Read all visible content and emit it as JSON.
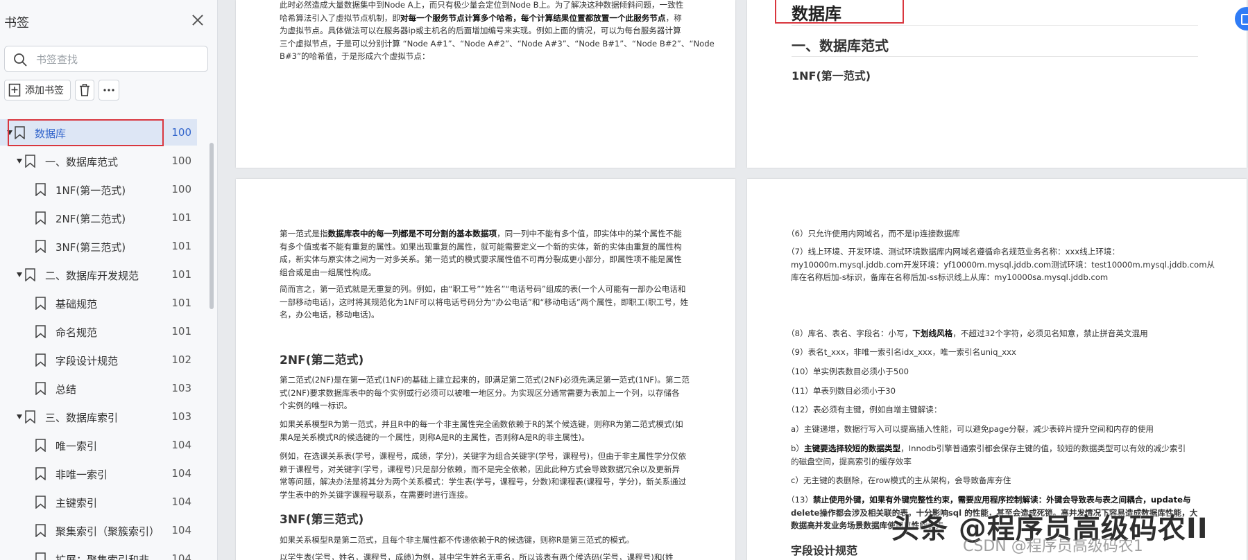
{
  "sidebar": {
    "title": "书签",
    "search_placeholder": "书签查找",
    "add_bookmark_label": "添加书签",
    "items": [
      {
        "label": "数据库",
        "page": "100"
      },
      {
        "label": "一、数据库范式",
        "page": "100"
      },
      {
        "label": "1NF(第一范式)",
        "page": "100"
      },
      {
        "label": "2NF(第二范式)",
        "page": "101"
      },
      {
        "label": "3NF(第三范式)",
        "page": "101"
      },
      {
        "label": "二、数据库开发规范",
        "page": "101"
      },
      {
        "label": "基础规范",
        "page": "101"
      },
      {
        "label": "命名规范",
        "page": "101"
      },
      {
        "label": "字段设计规范",
        "page": "102"
      },
      {
        "label": "总结",
        "page": "103"
      },
      {
        "label": "三、数据库索引",
        "page": "103"
      },
      {
        "label": "唯一索引",
        "page": "104"
      },
      {
        "label": "非唯一索引",
        "page": "104"
      },
      {
        "label": "主键索引",
        "page": "104"
      },
      {
        "label": "聚集索引（聚簇索引）",
        "page": "104"
      },
      {
        "label": "扩展：聚集索引和非",
        "page": "104"
      }
    ]
  },
  "page1": {
    "l1": "此时必然造成大量数据集中到Node A上，而只有极少量会定位到Node B上。为了解决这种数据倾斜问题，一致性",
    "l2a": "哈希算法引入了虚拟节点机制，即",
    "l2b": "对每一个服务节点计算多个哈希，每个计算结果位置都放置一个此服务节点",
    "l2c": "，称",
    "l3": "为虚拟节点。具体做法可以在服务器ip或主机名的后面增加编号来实现。例如上面的情况，可以为每台服务器计算",
    "l4": "三个虚拟节点，于是可以分别计算 “Node A#1”、“Node A#2”、“Node A#3”、“Node B#1”、“Node B#2”、“Node",
    "l5": "B#3”的哈希值，于是形成六个虚拟节点："
  },
  "page2": {
    "h1": "数据库",
    "h2": "一、数据库范式",
    "h3": "1NF(第一范式)"
  },
  "page3": {
    "p1l1a": "第一范式是指",
    "p1l1b": "数据库表中的每一列都是不可分割的基本数据项",
    "p1l1c": "，同一列中不能有多个值，即实体中的某个属性不能",
    "p1l2": "有多个值或者不能有重复的属性。如果出现重复的属性，就可能需要定义一个新的实体，新的实体由重复的属性构",
    "p1l3": "成，新实体与原实体之间为一对多关系。第一范式的模式要求属性值不可再分裂成更小部分，即属性项不能是属性",
    "p1l4": "组合或是由一组属性构成。",
    "p2l1": "简而言之，第一范式就是无重复的列。例如，由“职工号”“姓名”“电话号码”组成的表(一个人可能有一部办公电话和",
    "p2l2": "一部移动电话)，这时将其规范化为1NF可以将电话号码分为“办公电话”和“移动电话”两个属性，即职工(职工号，姓",
    "p2l3": "名，办公电话，移动电话)。",
    "h2nf": "2NF(第二范式)",
    "p3l1": "第二范式(2NF)是在第一范式(1NF)的基础上建立起来的，即满足第二范式(2NF)必须先满足第一范式(1NF)。第二范",
    "p3l2": "式(2NF)要求数据库表中的每个实例或行必须可以被唯一地区分。为实现区分通常需要为表加上一个列，以存储各",
    "p3l3": "个实例的唯一标识。",
    "p4l1": "如果关系模型R为第一范式，并且R中的每一个非主属性完全函数依赖于R的某个候选键，则称R为第二范式模式(如",
    "p4l2": "果A是关系模式R的候选键的一个属性，则称A是R的主属性，否则称A是R的非主属性)。",
    "p5l1": "例如，在选课关系表(学号，课程号，成绩，学分)，关键字为组合关键字(学号，课程号)，但由于非主属性学分仅依",
    "p5l2": "赖于课程号，对关键字(学号，课程号)只是部分依赖，而不是完全依赖，因此此种方式会导致数据冗余以及更新异",
    "p5l3": "常等问题，解决办法是将其分为两个关系模式：学生表(学号，课程号，分数)和课程表(课程号，学分)，新关系通过",
    "p5l4": "学生表中的外关键字课程号联系，在需要时进行连接。",
    "h3nf": "3NF(第三范式)",
    "p6l1": "如果关系模型R是第二范式，且每个非主属性都不传递依赖于R的候选键，则称R是第三范式的模式。",
    "p7l1": "以学生表(学号，姓名，课程号，成绩)为例，其中学生姓名无重名，所以该表有两个候选码(学号，课程号)和(姓"
  },
  "page4": {
    "r6": "（6）只允许使用内网域名，而不是ip连接数据库",
    "r7l1": "（7）线上环境、开发环境、测试环境数据库内网域名遵循命名规范业务名称：xxx线上环境：",
    "r7l2": "my10000m.mysql.jddb.com开发环境：yf10000m.mysql.jddb.com测试环境：test10000m.mysql.jddb.com从",
    "r7l3": "库在名称后加-s标识，备库在名称后加-ss标识线上从库：my10000sa.mysql.jddb.com",
    "r8a": "（8）库名、表名、字段名：小写，",
    "r8b": "下划线风格",
    "r8c": "，不超过32个字符，必须见名知意，禁止拼音英文混用",
    "r9": "（9）表名t_xxx，非唯一索引名idx_xxx，唯一索引名uniq_xxx",
    "r10": "（10）单实例表数目必须小于500",
    "r11": "（11）单表列数目必须小于30",
    "r12": "（12）表必须有主键，例如自增主键解读：",
    "ra": "a）主键递增，数据行写入可以提高插入性能，可以避免page分裂，减少表碎片提升空间和内存的使用",
    "rb1a": "b）",
    "rb1b": "主键要选择较短的数据类型",
    "rb1c": "，Innodb引擎普通索引都会保存主键的值，较短的数据类型可以有效的减少索引",
    "rb2": "的磁盘空间，提高索引的缓存效率",
    "rc": "c）无主键的表删除，在row模式的主从架构，会导致备库夯住",
    "r13l1a": "（13）",
    "r13l1b": "禁止使用外键，如果有外键完整性约束，需要应用程序控制解读：外键会导致表与表之间耦合，update与",
    "r13l2": "delete操作都会涉及相关联的表，十分影响sql 的性能，甚至会造成死锁。高并发情况下容易造成数据库性能，大",
    "r13l3": "数据高并发业务场景数据库使用以性能优先",
    "h_field": "字段设计规范"
  },
  "watermark": {
    "main": "头条 @程序员高级码农II",
    "sub": "CSDN @程序员高级码农1"
  }
}
